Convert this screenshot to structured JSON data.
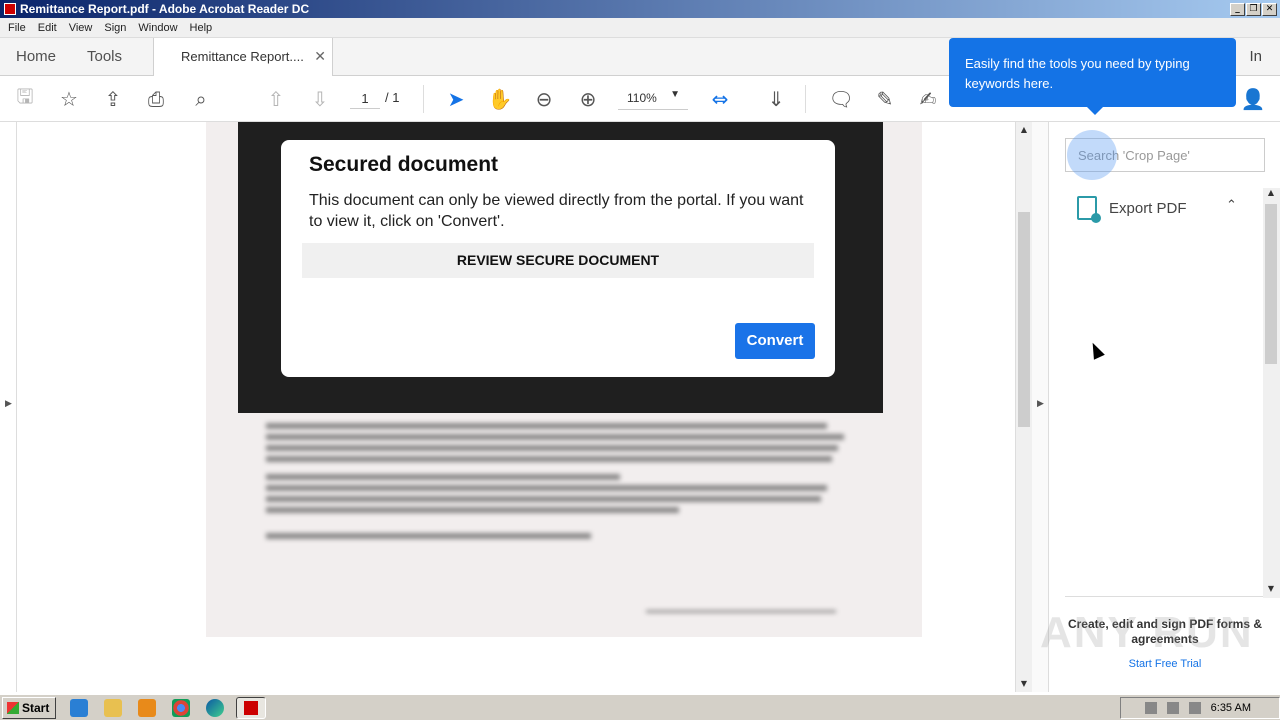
{
  "window": {
    "title": "Remittance Report.pdf - Adobe Acrobat Reader DC"
  },
  "menu": [
    "File",
    "Edit",
    "View",
    "Sign",
    "Window",
    "Help"
  ],
  "tabs": {
    "home": "Home",
    "tools": "Tools",
    "document": "Remittance Report....",
    "signin": "In"
  },
  "toolbar": {
    "page_current": "1",
    "page_total": "/ 1",
    "zoom": "110%"
  },
  "modal": {
    "title": "Secured document",
    "message": "This document can only be viewed directly from the portal. If you want to view it, click on 'Convert'.",
    "review_label": "REVIEW SECURE DOCUMENT",
    "convert_label": "Convert"
  },
  "tooltip": {
    "text": "Easily find the tools you need by typing keywords here."
  },
  "right_pane": {
    "search_placeholder": "Search 'Crop Page'",
    "export_label": "Export PDF",
    "promo_text": "Create, edit and sign PDF forms & agreements",
    "trial_label": "Start Free Trial"
  },
  "taskbar": {
    "start_label": "Start",
    "clock": "6:35 AM"
  },
  "watermark": "ANY RUN",
  "colors": {
    "accent": "#1473e6",
    "convert": "#1a73e8",
    "overlay": "#1f1f1f"
  }
}
